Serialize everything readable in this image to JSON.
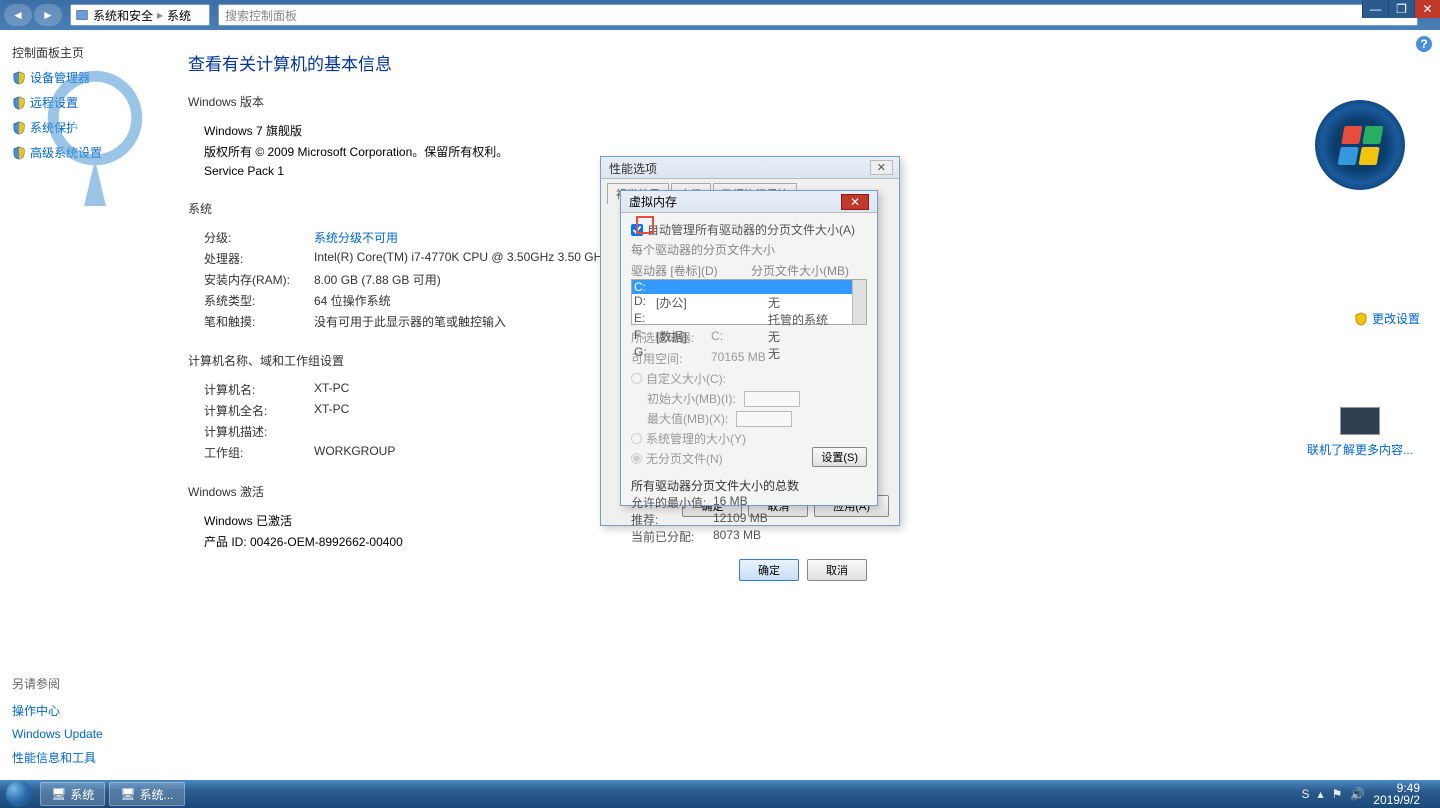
{
  "titlebar": {
    "breadcrumb": {
      "l1": "系统和安全",
      "l2": "系统"
    },
    "search_placeholder": "搜索控制面板"
  },
  "window_buttons": {
    "min": "—",
    "max": "❐",
    "close": "✕"
  },
  "sidebar": {
    "top": [
      {
        "label": "控制面板主页",
        "shield": false
      },
      {
        "label": "设备管理器",
        "shield": true
      },
      {
        "label": "远程设置",
        "shield": true
      },
      {
        "label": "系统保护",
        "shield": true
      },
      {
        "label": "高级系统设置",
        "shield": true
      }
    ],
    "bottom_header": "另请参阅",
    "bottom": [
      {
        "label": "操作中心"
      },
      {
        "label": "Windows Update"
      },
      {
        "label": "性能信息和工具"
      }
    ]
  },
  "page": {
    "title": "查看有关计算机的基本信息",
    "version_h": "Windows 版本",
    "version_lines": [
      "Windows 7 旗舰版",
      "版权所有 © 2009 Microsoft Corporation。保留所有权利。",
      "Service Pack 1"
    ],
    "system_h": "系统",
    "system_rows": [
      {
        "l": "分级:",
        "v": "系统分级不可用",
        "link": true
      },
      {
        "l": "处理器:",
        "v": "Intel(R) Core(TM) i7-4770K CPU @ 3.50GHz   3.50 GHz"
      },
      {
        "l": "安装内存(RAM):",
        "v": "8.00 GB (7.88 GB 可用)"
      },
      {
        "l": "系统类型:",
        "v": "64 位操作系统"
      },
      {
        "l": "笔和触摸:",
        "v": "没有可用于此显示器的笔或触控输入"
      }
    ],
    "computer_h": "计算机名称、域和工作组设置",
    "computer_rows": [
      {
        "l": "计算机名:",
        "v": "XT-PC"
      },
      {
        "l": "计算机全名:",
        "v": "XT-PC"
      },
      {
        "l": "计算机描述:",
        "v": ""
      },
      {
        "l": "工作组:",
        "v": "WORKGROUP"
      }
    ],
    "activation_h": "Windows 激活",
    "activation_lines": [
      "Windows 已激活",
      "产品 ID: 00426-OEM-8992662-00400"
    ],
    "change_settings": "更改设置",
    "more_online": "联机了解更多内容..."
  },
  "perf_dialog": {
    "title": "性能选项",
    "tabs": [
      "视觉效果",
      "高级",
      "数据执行保护"
    ],
    "ok": "确定",
    "cancel": "取消",
    "apply": "应用(A)",
    "close": "✕"
  },
  "vm_dialog": {
    "title": "虚拟内存",
    "auto_manage": "自动管理所有驱动器的分页文件大小(A)",
    "per_drive_h": "每个驱动器的分页文件大小",
    "drive_col": "驱动器 [卷标](D)",
    "size_col": "分页文件大小(MB)",
    "drives": [
      {
        "d": "C:",
        "label": "",
        "size": ""
      },
      {
        "d": "D:",
        "label": "[办公]",
        "size": "无"
      },
      {
        "d": "E:",
        "label": "",
        "size": "托管的系统"
      },
      {
        "d": "F:",
        "label": "[数据]",
        "size": "无"
      },
      {
        "d": "G:",
        "label": "",
        "size": "无"
      }
    ],
    "selected_drive_l": "所选驱动器:",
    "selected_drive_v": "C:",
    "free_space_l": "可用空间:",
    "free_space_v": "70165 MB",
    "custom_size": "自定义大小(C):",
    "initial_size": "初始大小(MB)(I):",
    "max_size": "最大值(MB)(X):",
    "system_managed": "系统管理的大小(Y)",
    "no_paging": "无分页文件(N)",
    "set_btn": "设置(S)",
    "totals_h": "所有驱动器分页文件大小的总数",
    "min_allowed_l": "允许的最小值:",
    "min_allowed_v": "16 MB",
    "recommended_l": "推荐:",
    "recommended_v": "12109 MB",
    "current_l": "当前已分配:",
    "current_v": "8073 MB",
    "ok": "确定",
    "cancel": "取消"
  },
  "taskbar": {
    "items": [
      "系统",
      "系统..."
    ],
    "time": "9:49",
    "date": "2019/9/2"
  }
}
